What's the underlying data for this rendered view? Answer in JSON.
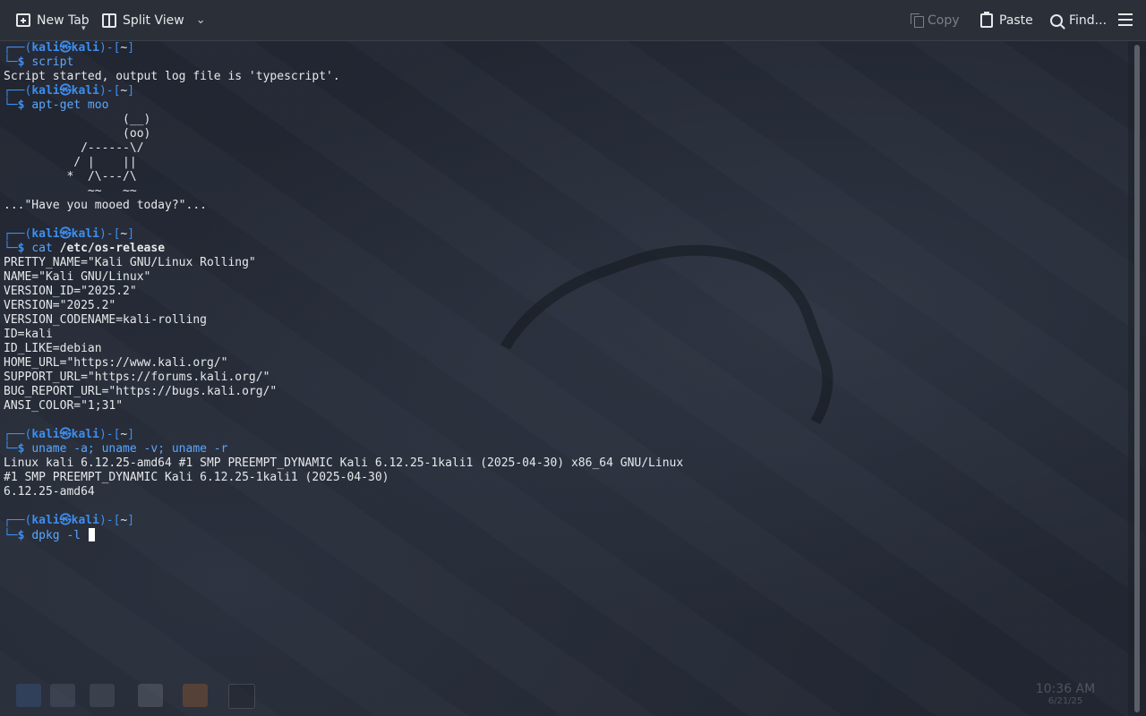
{
  "toolbar": {
    "new_tab": "New Tab",
    "split_view": "Split View",
    "copy": "Copy",
    "paste": "Paste",
    "find": "Find..."
  },
  "terminal": {
    "prompt": {
      "user": "kali",
      "at": "㉿",
      "host": "kali",
      "dir": "~"
    },
    "lines": [
      {
        "kind": "prompt1"
      },
      {
        "kind": "cmd",
        "text": "script"
      },
      {
        "kind": "out",
        "text": "Script started, output log file is 'typescript'."
      },
      {
        "kind": "prompt1"
      },
      {
        "kind": "cmd",
        "text": "apt-get moo"
      },
      {
        "kind": "out",
        "text": "                 (__)"
      },
      {
        "kind": "out",
        "text": "                 (oo)"
      },
      {
        "kind": "out",
        "text": "           /------\\/"
      },
      {
        "kind": "out",
        "text": "          / |    ||"
      },
      {
        "kind": "out",
        "text": "         *  /\\---/\\"
      },
      {
        "kind": "out",
        "text": "            ~~   ~~"
      },
      {
        "kind": "out",
        "text": "...\"Have you mooed today?\"..."
      },
      {
        "kind": "out",
        "text": ""
      },
      {
        "kind": "prompt1"
      },
      {
        "kind": "cmd",
        "text": "cat ",
        "arg": "/etc/os-release"
      },
      {
        "kind": "out",
        "text": "PRETTY_NAME=\"Kali GNU/Linux Rolling\""
      },
      {
        "kind": "out",
        "text": "NAME=\"Kali GNU/Linux\""
      },
      {
        "kind": "out",
        "text": "VERSION_ID=\"2025.2\""
      },
      {
        "kind": "out",
        "text": "VERSION=\"2025.2\""
      },
      {
        "kind": "out",
        "text": "VERSION_CODENAME=kali-rolling"
      },
      {
        "kind": "out",
        "text": "ID=kali"
      },
      {
        "kind": "out",
        "text": "ID_LIKE=debian"
      },
      {
        "kind": "out",
        "text": "HOME_URL=\"https://www.kali.org/\""
      },
      {
        "kind": "out",
        "text": "SUPPORT_URL=\"https://forums.kali.org/\""
      },
      {
        "kind": "out",
        "text": "BUG_REPORT_URL=\"https://bugs.kali.org/\""
      },
      {
        "kind": "out",
        "text": "ANSI_COLOR=\"1;31\""
      },
      {
        "kind": "out",
        "text": ""
      },
      {
        "kind": "prompt1"
      },
      {
        "kind": "cmd",
        "text": "uname -a; uname -v; uname -r"
      },
      {
        "kind": "out",
        "text": "Linux kali 6.12.25-amd64 #1 SMP PREEMPT_DYNAMIC Kali 6.12.25-1kali1 (2025-04-30) x86_64 GNU/Linux"
      },
      {
        "kind": "out",
        "text": "#1 SMP PREEMPT_DYNAMIC Kali 6.12.25-1kali1 (2025-04-30)"
      },
      {
        "kind": "out",
        "text": "6.12.25-amd64"
      },
      {
        "kind": "out",
        "text": ""
      },
      {
        "kind": "prompt1"
      },
      {
        "kind": "input",
        "text": "dpkg -l "
      }
    ]
  },
  "taskbar": {
    "time": "10:36 AM",
    "date": "6/21/25"
  },
  "colors": {
    "prompt": "#3d8ef0",
    "command": "#5aa6ff",
    "text": "#e6e8ea"
  }
}
